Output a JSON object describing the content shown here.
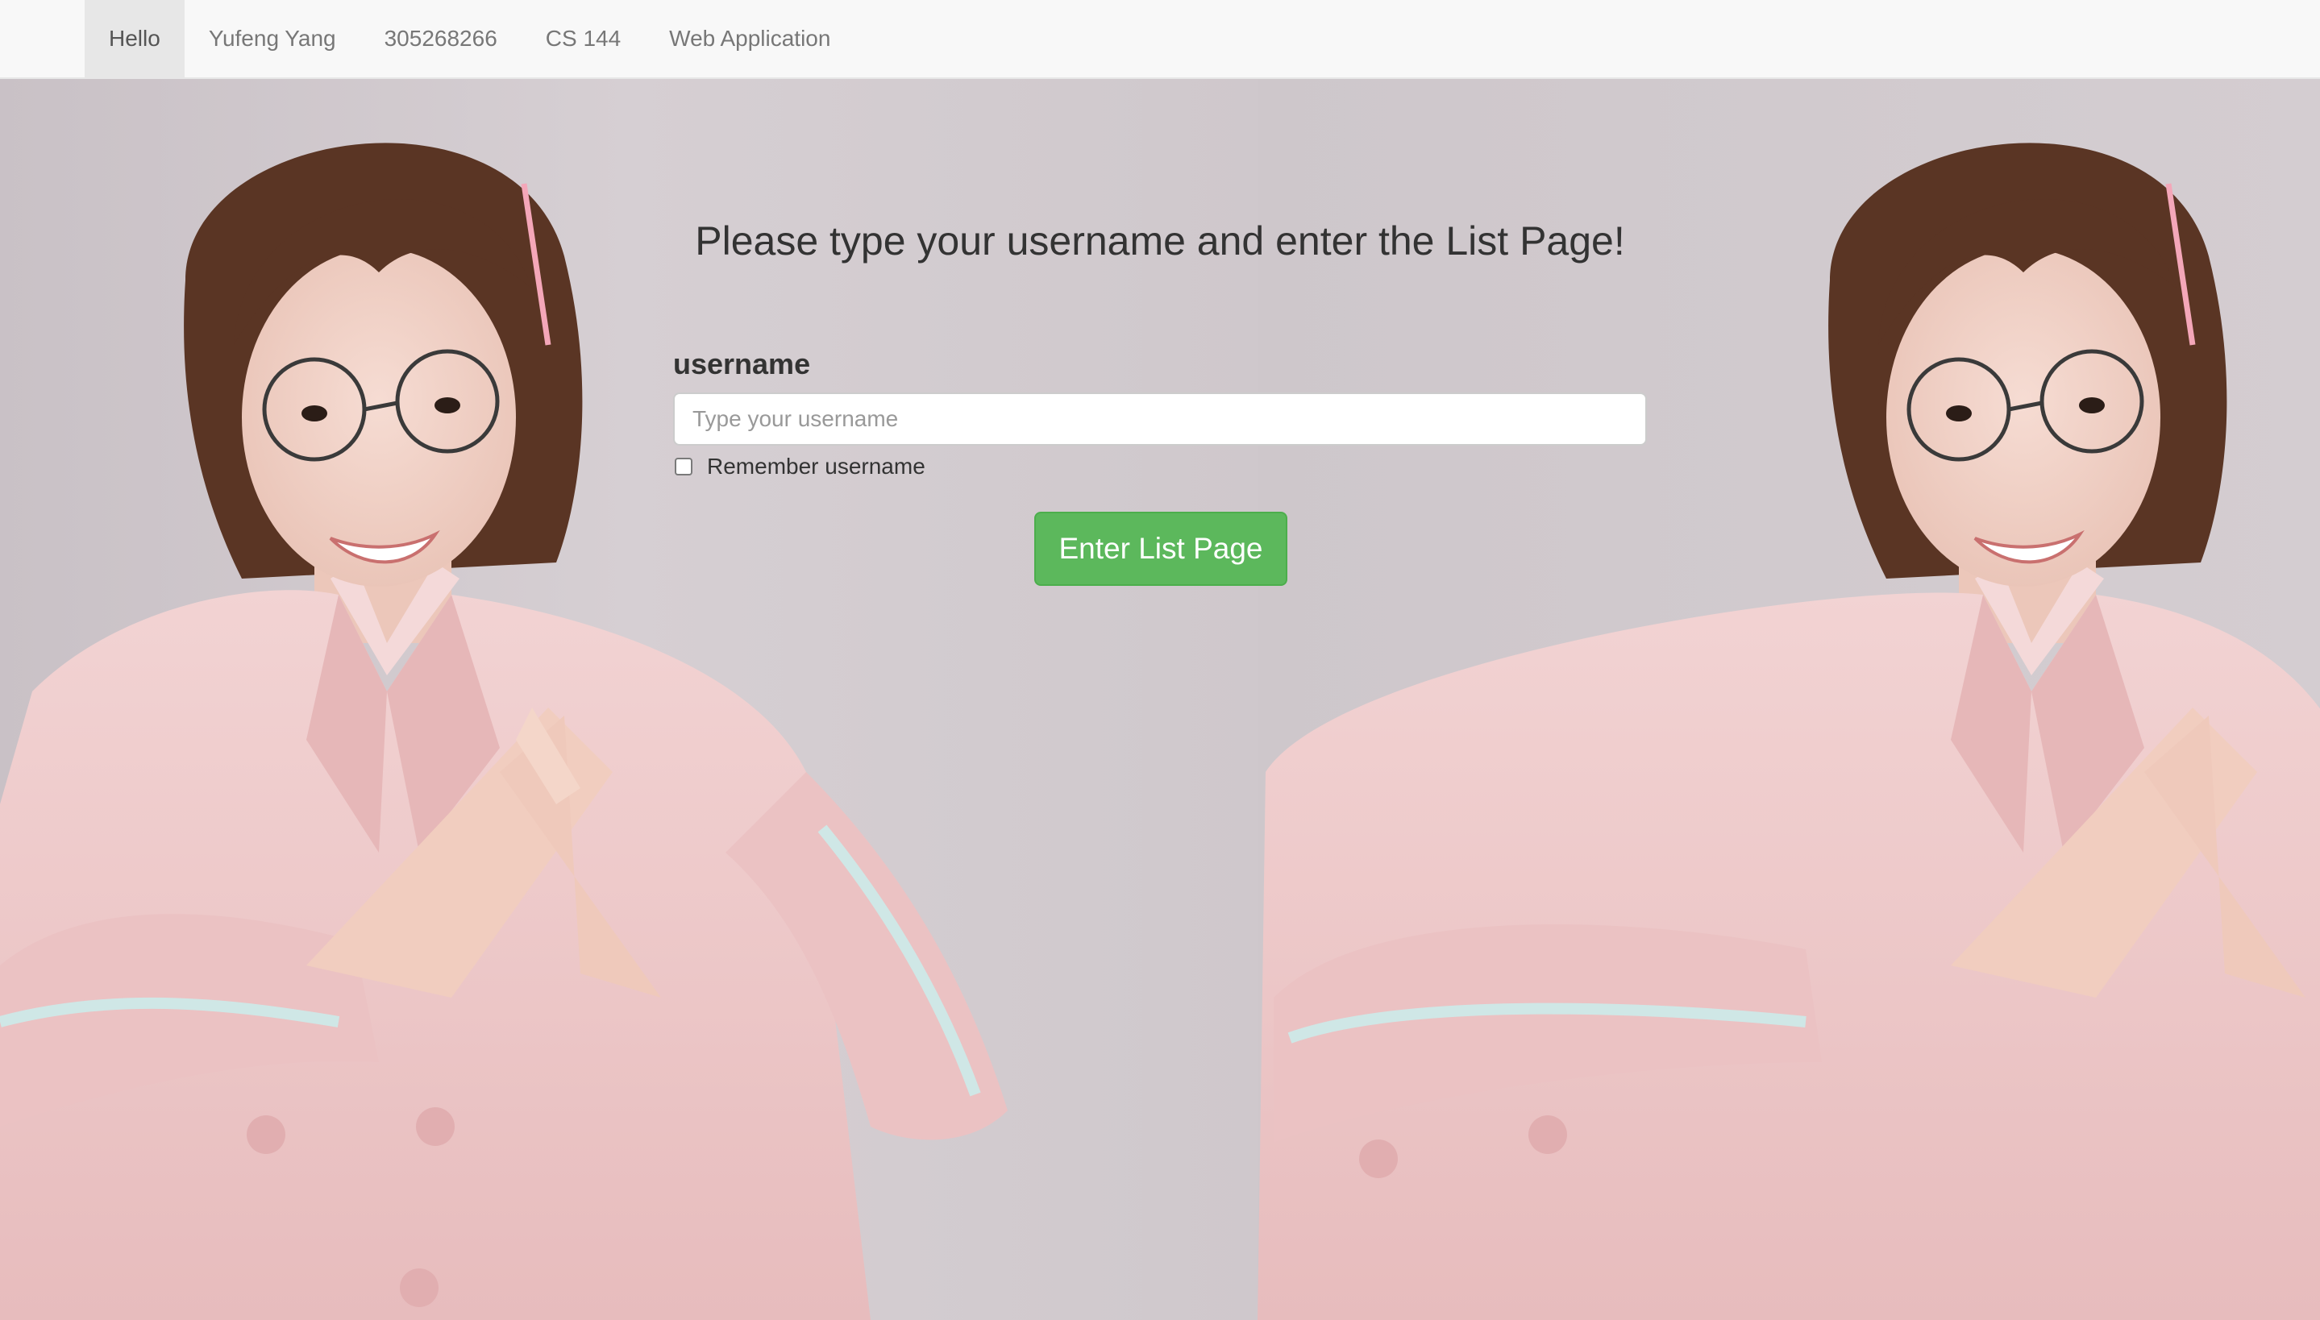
{
  "navbar": {
    "items": [
      {
        "label": "Hello",
        "active": true
      },
      {
        "label": "Yufeng Yang",
        "active": false
      },
      {
        "label": "305268266",
        "active": false
      },
      {
        "label": "CS 144",
        "active": false
      },
      {
        "label": "Web Application",
        "active": false
      }
    ]
  },
  "main": {
    "headline": "Please type your username and enter the List Page!",
    "username_label": "username",
    "username_placeholder": "Type your username",
    "username_value": "",
    "remember_label": "Remember username",
    "remember_checked": false,
    "enter_button_label": "Enter List Page"
  },
  "colors": {
    "navbar_bg": "#f8f8f8",
    "nav_active_bg": "#e7e7e7",
    "button_green": "#5cb85c",
    "background_gray": "#d9d3d6",
    "jacket_pink": "#ecc6c6"
  }
}
